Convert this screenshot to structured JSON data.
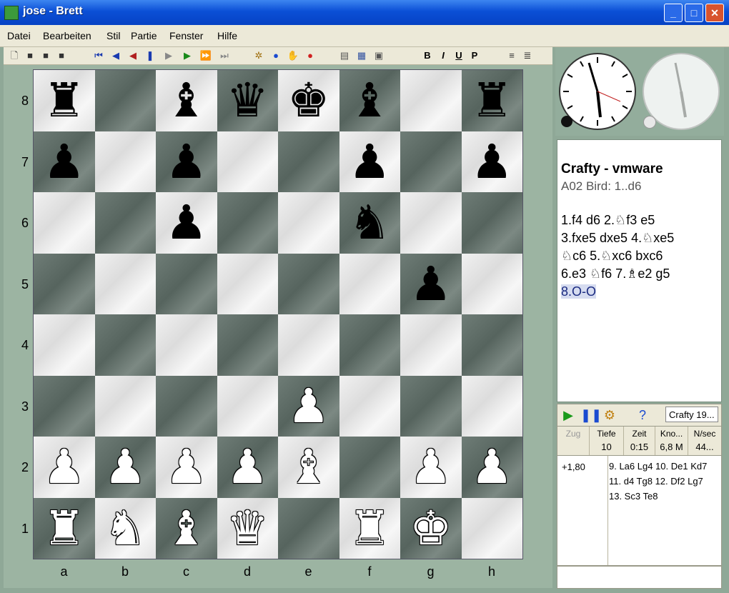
{
  "window": {
    "title": "jose - Brett",
    "minimize": "_",
    "maximize": "□",
    "close": "✕"
  },
  "menu": [
    {
      "label": "Datei"
    },
    {
      "label": "Bearbeiten"
    },
    {
      "label": "Stil"
    },
    {
      "label": "Partie"
    },
    {
      "label": "Fenster"
    },
    {
      "label": "Hilfe"
    }
  ],
  "toolbar": {
    "icons": [
      "new-document-icon",
      "open-icon",
      "save-icon",
      "save-as-icon",
      "first-move-icon",
      "back-icon",
      "back-red-icon",
      "pause-icon",
      "forward-icon",
      "play-icon",
      "fast-forward-icon",
      "last-move-icon",
      "engine-icon",
      "globe-icon",
      "hand-icon",
      "stop-icon",
      "notation-icon",
      "calendar-icon",
      "settings-icon",
      "bold-icon",
      "italic-icon",
      "underline-icon",
      "piece-letter-icon",
      "align-left-icon",
      "align-justify-icon"
    ],
    "format": {
      "bold": "B",
      "italic": "I",
      "underline": "U",
      "piece": "P"
    }
  },
  "board": {
    "ranks": [
      "8",
      "7",
      "6",
      "5",
      "4",
      "3",
      "2",
      "1"
    ],
    "files": [
      "a",
      "b",
      "c",
      "d",
      "e",
      "f",
      "g",
      "h"
    ],
    "position": [
      [
        "r",
        "",
        "b",
        "q",
        "k",
        "b",
        "",
        "r"
      ],
      [
        "p",
        "",
        "p",
        "",
        "",
        "p",
        "",
        "p"
      ],
      [
        "",
        "",
        "p",
        "",
        "",
        "n",
        "",
        ""
      ],
      [
        "",
        "",
        "",
        "",
        "",
        "",
        "p",
        ""
      ],
      [
        "",
        "",
        "",
        "",
        "",
        "",
        "",
        ""
      ],
      [
        "",
        "",
        "",
        "",
        "P",
        "",
        "",
        ""
      ],
      [
        "P",
        "P",
        "P",
        "P",
        "B",
        "",
        "P",
        "P"
      ],
      [
        "R",
        "N",
        "B",
        "Q",
        "",
        "R",
        "K",
        ""
      ]
    ]
  },
  "game": {
    "title": "Crafty - vmware",
    "opening": "A02 Bird: 1..d6",
    "moves": [
      "1.f4 d6 2.♘f3 e5",
      "3.fxe5 dxe5 4.♘xe5",
      "♘c6 5.♘xc6 bxc6",
      "6.e3 ♘f6 7.♗e2 g5"
    ],
    "current_move": "8.O-O"
  },
  "engine": {
    "name": "Crafty 19...",
    "headers": {
      "move": "Zug",
      "depth": "Tiefe",
      "time": "Zeit",
      "nodes": "Kno...",
      "nps": "N/sec"
    },
    "values": {
      "move": "",
      "depth": "10",
      "time": "0:15",
      "nodes": "6,8 M",
      "nps": "44..."
    },
    "score": "+1,80",
    "pv": "9. La6 Lg4 10. De1 Kd7 11. d4 Tg8 12. Df2 Lg7 13. Sc3 Te8"
  }
}
